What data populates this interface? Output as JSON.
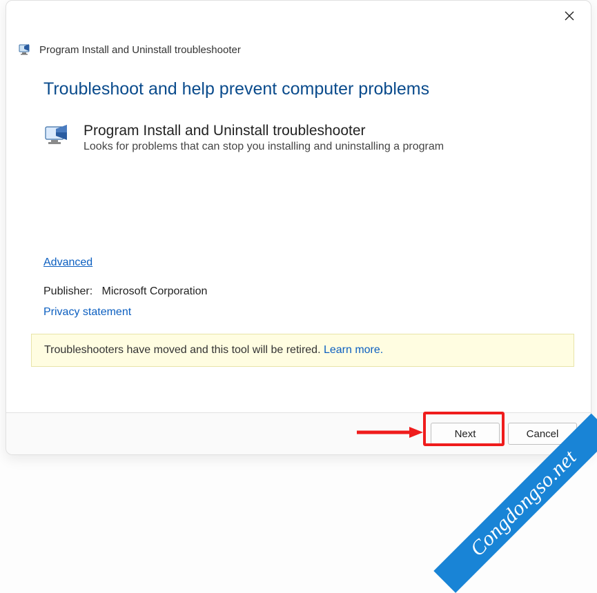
{
  "header": {
    "title": "Program Install and Uninstall troubleshooter"
  },
  "page": {
    "heading": "Troubleshoot and help prevent computer problems",
    "troubleshooter": {
      "title": "Program Install and Uninstall troubleshooter",
      "description": "Looks for problems that can stop you installing and uninstalling a program"
    },
    "advanced_link": "Advanced",
    "publisher_label": "Publisher:",
    "publisher_value": "Microsoft Corporation",
    "privacy_link": "Privacy statement",
    "notice_text": "Troubleshooters have moved and this tool will be retired. ",
    "notice_link": "Learn more."
  },
  "footer": {
    "next_label": "Next",
    "cancel_label": "Cancel"
  },
  "watermark": "Congdongso.net"
}
